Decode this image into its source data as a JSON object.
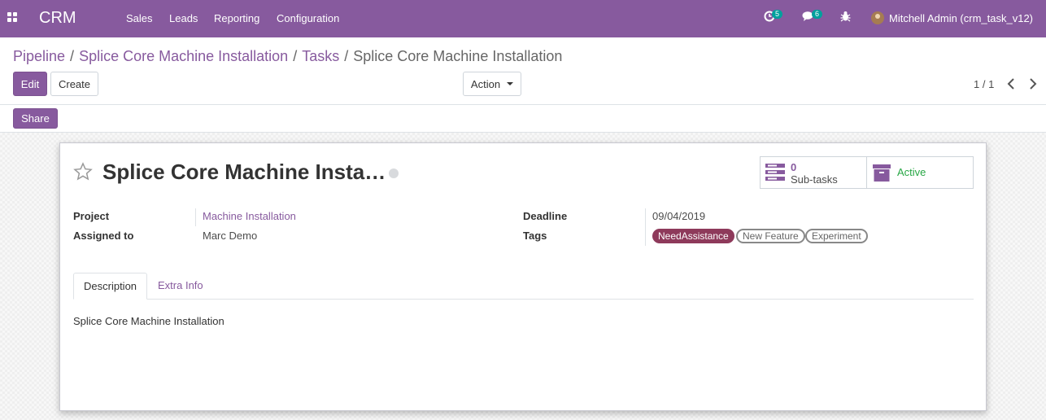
{
  "navbar": {
    "brand": "CRM",
    "menu": [
      "Sales",
      "Leads",
      "Reporting",
      "Configuration"
    ],
    "activity_count": "5",
    "message_count": "6",
    "user": "Mitchell Admin (crm_task_v12)",
    "background_color": "#875a9e"
  },
  "breadcrumb": {
    "items": [
      "Pipeline",
      "Splice Core Machine Installation",
      "Tasks"
    ],
    "current": "Splice Core Machine Installation"
  },
  "buttons": {
    "edit": "Edit",
    "create": "Create",
    "action": "Action",
    "share": "Share"
  },
  "pager": {
    "value": "1 / 1"
  },
  "task": {
    "title": "Splice Core Machine Installation",
    "subtasks_count": "0",
    "subtasks_label": "Sub-tasks",
    "active_label": "Active",
    "fields": {
      "project_label": "Project",
      "project_value": "Machine Installation",
      "assigned_label": "Assigned to",
      "assigned_value": "Marc Demo",
      "deadline_label": "Deadline",
      "deadline_value": "09/04/2019",
      "tags_label": "Tags"
    },
    "tags": [
      "NeedAssistance",
      "New Feature",
      "Experiment"
    ],
    "tabs": [
      "Description",
      "Extra Info"
    ],
    "description": "Splice Core Machine Installation"
  },
  "colors": {
    "primary": "#875a9e",
    "badge": "#00a09d",
    "tag_need_assistance": "#8e3a5b",
    "active_green": "#28a745"
  },
  "icons": [
    "apps-icon",
    "activity-clock-icon",
    "messages-icon",
    "bug-icon",
    "star-icon",
    "kanban-state-icon",
    "subtasks-icon",
    "archive-box-icon",
    "chevron-left-icon",
    "chevron-right-icon",
    "caret-down-icon"
  ]
}
